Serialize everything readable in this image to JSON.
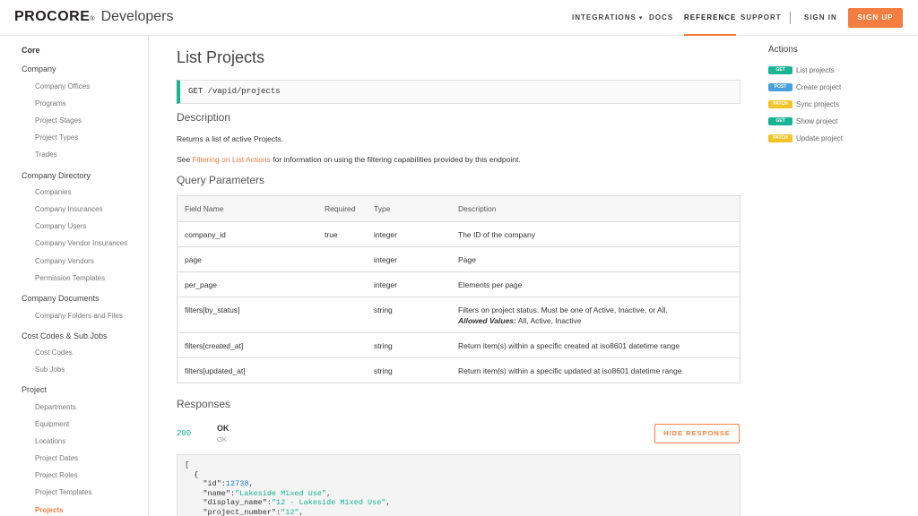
{
  "header": {
    "brand": "PROCORE",
    "brand_suffix": "Developers",
    "nav": [
      "INTEGRATIONS",
      "DOCS",
      "REFERENCE",
      "SUPPORT"
    ],
    "sign_in": "SIGN IN",
    "sign_up": "SIGN UP",
    "accent": "#f47e42"
  },
  "sidebar": {
    "top": "Core",
    "groups": [
      {
        "label": "Company",
        "items": [
          "Company Offices",
          "Programs",
          "Project Stages",
          "Project Types",
          "Trades"
        ]
      },
      {
        "label": "Company Directory",
        "items": [
          "Companies",
          "Company Insurances",
          "Company Users",
          "Company Vendor Insurances",
          "Company Vendors",
          "Permission Templates"
        ]
      },
      {
        "label": "Company Documents",
        "items": [
          "Company Folders and Files"
        ]
      },
      {
        "label": "Cost Codes & Sub Jobs",
        "items": [
          "Cost Codes",
          "Sub Jobs"
        ]
      },
      {
        "label": "Project",
        "items": [
          "Departments",
          "Equipment",
          "Locations",
          "Project Dates",
          "Project Roles",
          "Project Templates",
          "Projects"
        ]
      }
    ],
    "active_item": "Projects"
  },
  "main": {
    "title": "List Projects",
    "endpoint": "GET /vapid/projects",
    "description_heading": "Description",
    "description_text": "Returns a list of active Projects.",
    "see_prefix": "See ",
    "see_link": "Filtering on List Actions",
    "see_suffix": " for information on using the filtering capabilities provided by this endpoint.",
    "query_heading": "Query Parameters",
    "table": {
      "headers": [
        "Field Name",
        "Required",
        "Type",
        "Description"
      ],
      "rows": [
        {
          "field": "company_id",
          "required": "true",
          "type": "integer",
          "description": "The ID of the company"
        },
        {
          "field": "page",
          "required": "",
          "type": "integer",
          "description": "Page"
        },
        {
          "field": "per_page",
          "required": "",
          "type": "integer",
          "description": "Elements per page"
        },
        {
          "field": "filters[by_status]",
          "required": "",
          "type": "string",
          "description": "Filters on project status. Must be one of Active, Inactive, or All.",
          "allowed_label": "Allowed Values:",
          "allowed_values": " All, Active, Inactive"
        },
        {
          "field": "filters[created_at]",
          "required": "",
          "type": "string",
          "description": "Return item(s) within a specific created at iso8601 datetime range"
        },
        {
          "field": "filters[updated_at]",
          "required": "",
          "type": "string",
          "description": "Return item(s) within a specific updated at iso8601 datetime range"
        }
      ]
    },
    "responses_heading": "Responses",
    "response": {
      "code": "200",
      "status": "OK",
      "status_sub": "OK",
      "hide_button": "HIDE RESPONSE"
    },
    "code_lines": [
      "[",
      "  {",
      "    \"id\":12738,",
      "    \"name\":\"Lakeside Mixed Use\",",
      "    \"display_name\":\"12 - Lakeside Mixed Use\",",
      "    \"project_number\":\"12\","
    ]
  },
  "actions": {
    "title": "Actions",
    "items": [
      {
        "method": "GET",
        "label": "List projects",
        "color": "#1ab394"
      },
      {
        "method": "POST",
        "label": "Create project",
        "color": "#4a9fe0"
      },
      {
        "method": "PATCH",
        "label": "Sync projects",
        "color": "#f2c428"
      },
      {
        "method": "GET",
        "label": "Show project",
        "color": "#1ab394"
      },
      {
        "method": "PATCH",
        "label": "Update project",
        "color": "#f2c428"
      }
    ]
  }
}
